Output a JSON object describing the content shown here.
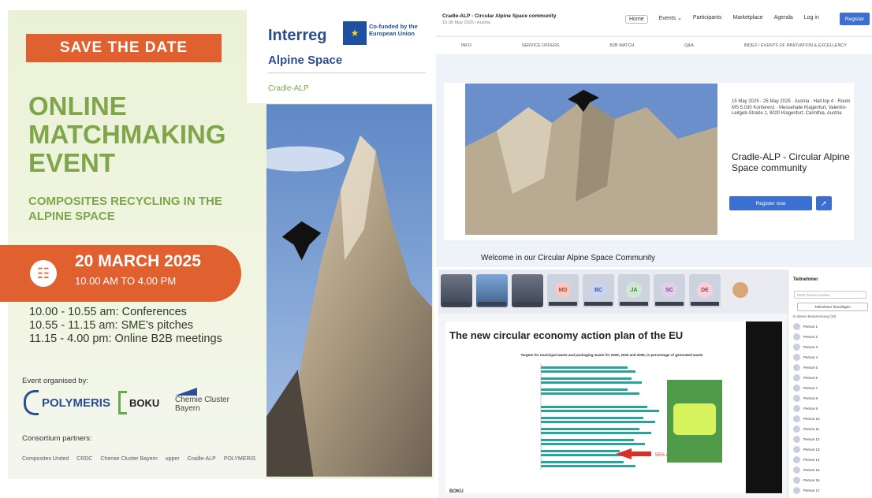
{
  "poster": {
    "save_the_date": "SAVE THE DATE",
    "title": "ONLINE MATCHMAKING EVENT",
    "subtitle": "COMPOSITES RECYCLING IN THE ALPINE SPACE",
    "date": "20 MARCH 2025",
    "hours": "10.00 AM TO 4.00 PM",
    "schedule": [
      "10.00 - 10.55 am: Conferences",
      "10.55 - 11.15 am: SME's pitches",
      "11.15 - 4.00 pm: Online B2B meetings"
    ],
    "organised_by": "Event organised by:",
    "organisers": [
      "POLYMERIS",
      "BOKU",
      "Chemie Cluster Bayern"
    ],
    "consortium": "Consortium partners:",
    "partners": [
      "Composites United",
      "CRDC",
      "Chemie Cluster Bayern",
      "upper",
      "Cradle-ALP",
      "POLYMERIS"
    ],
    "brand": "Interreg",
    "cofunded": "Co-funded by the European Union",
    "program": "Alpine Space",
    "project": "Cradle-ALP",
    "accent": "#e06030",
    "green": "#7fa64a"
  },
  "webpage": {
    "title": "Cradle-ALP - Circular Alpine Space community",
    "subtitle": "15-30 May 2025 | Austria",
    "nav": [
      "Home",
      "Events ⌄",
      "Participants",
      "Marketplace",
      "Agenda",
      "Log in"
    ],
    "register": "Register",
    "tabs": [
      "INFO",
      "SERVICE OFFERS",
      "B2B MATCH",
      "Q&A",
      "INDEX / EVENTS OF INNOVATION & EXCELLENCY"
    ],
    "meta": "15 May 2025 - 25 May 2025 · Austria · Hall top 4 · Room MS 5.030 Konferenz · Messehalle Klagenfurt, Valentin-Leitgeb-Straße 1, 9020 Klagenfurt, Carinthia, Austria",
    "event_title": "Cradle-ALP - Circular Alpine Space community",
    "register_now": "Register now",
    "welcome": "Welcome in our Circular Alpine Space Community"
  },
  "videocall": {
    "participants_strip": [
      "MD",
      "BC",
      "JA",
      "SC",
      "DE"
    ],
    "slide_title": "The new circular economy action plan of the EU",
    "chart_title": "Targets for municipal waste and packaging waste for 2025, 2030 and 2035, in percentage of generated waste",
    "callout": "55% and 65%",
    "sidebar_title": "Teilnehmer",
    "search_placeholder": "Nach Person suchen",
    "invite": "Teilnehmer hinzufügen",
    "in_meeting": "In dieser Besprechung (18)",
    "people": [
      "Person 1",
      "Person 2",
      "Person 3",
      "Person 4",
      "Person 5",
      "Person 6",
      "Person 7",
      "Person 8",
      "Person 9",
      "Person 10",
      "Person 11",
      "Person 12",
      "Person 13",
      "Person 14",
      "Person 15",
      "Person 16",
      "Person 17"
    ],
    "footer_logo": "BOKU"
  }
}
